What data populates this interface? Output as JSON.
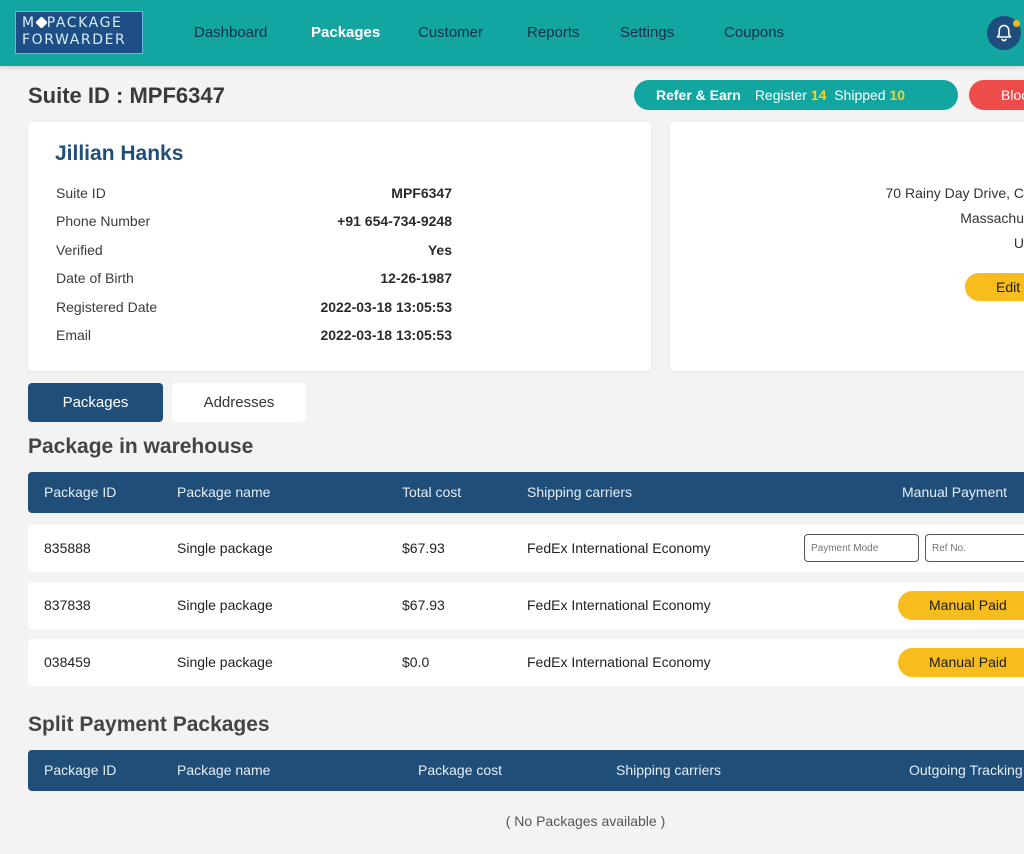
{
  "nav": {
    "logo_line1_a": "M",
    "logo_line1_b": "PACKAGE",
    "logo_line2": "FORWARDER",
    "items": [
      "Dashboard",
      "Packages",
      "Customer",
      "Reports",
      "Settings",
      "Coupons"
    ],
    "active": "Packages"
  },
  "header": {
    "suite_title": "Suite ID : MPF6347",
    "refer_label": "Refer & Earn",
    "register_label": "Register",
    "register_count": "14",
    "shipped_label": "Shipped",
    "shipped_count": "10",
    "block_label": "Block"
  },
  "customer": {
    "name": "Jillian Hanks",
    "fields": [
      {
        "label": "Suite ID",
        "value": "MPF6347"
      },
      {
        "label": "Phone Number",
        "value": "+91 654-734-9248"
      },
      {
        "label": "Verified",
        "value": "Yes"
      },
      {
        "label": "Date of Birth",
        "value": "12-26-1987"
      },
      {
        "label": "Registered Date",
        "value": "2022-03-18 13:05:53"
      },
      {
        "label": "Email",
        "value": "2022-03-18 13:05:53"
      }
    ]
  },
  "address": {
    "line1": "70 Rainy Day Drive, C",
    "line2": "Massachu",
    "line3": "U",
    "edit_label": "Edit"
  },
  "tabs": {
    "packages": "Packages",
    "addresses": "Addresses"
  },
  "warehouse": {
    "title": "Package in warehouse",
    "columns": [
      "Package ID",
      "Package name",
      "Total cost",
      "Shipping carriers",
      "Manual Payment"
    ],
    "rows": [
      {
        "id": "835888",
        "name": "Single package",
        "cost": "$67.93",
        "carrier": "FedEx International Economy",
        "payment_mode_placeholder": "Payment Mode",
        "ref_placeholder": "Ref No."
      },
      {
        "id": "837838",
        "name": "Single package",
        "cost": "$67.93",
        "carrier": "FedEx International Economy",
        "action": "Manual Paid"
      },
      {
        "id": "038459",
        "name": "Single package",
        "cost": "$0.0",
        "carrier": "FedEx International Economy",
        "action": "Manual Paid"
      }
    ]
  },
  "split": {
    "title": "Split Payment Packages",
    "columns": [
      "Package ID",
      "Package name",
      "Package cost",
      "Shipping carriers",
      "Outgoing Tracking"
    ],
    "empty_text": "( No Packages available )"
  },
  "colors": {
    "nav_bg": "#13a5a0",
    "navy": "#1f4e79",
    "yellow": "#f6bd1c",
    "red": "#ee4b4b"
  }
}
